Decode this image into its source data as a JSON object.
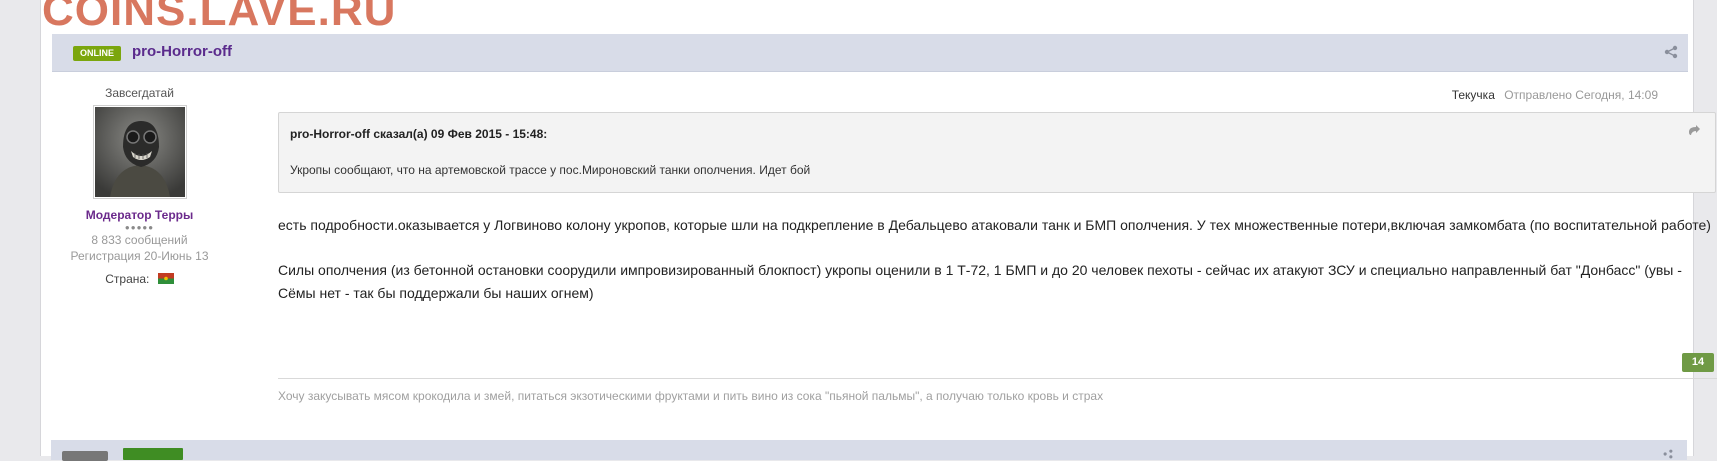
{
  "watermark": "COINS.LAVE.RU",
  "post": {
    "online_label": "ONLINE",
    "author": "pro-Horror-off",
    "rank": "Завсегдатай",
    "group": "Модератор Терры",
    "pips": "●●●●●",
    "posts_count": "8 833 сообщений",
    "registered": "Регистрация 20-Июнь 13",
    "country_label": "Страна:",
    "meta_user": "Текучка",
    "meta_date": "Отправлено Сегодня, 14:09",
    "quote": {
      "cite": "pro-Horror-off сказал(а) 09 Фев 2015 - 15:48:",
      "text": "Укропы сообщают, что на артемовской трассе у пос.Мироновский танки ополчения. Идет бой"
    },
    "body": [
      "есть подробности.оказывается у Логвиново колону укропов, которые шли на подкрепление в Дебальцево атаковали танк и БМП ополчения. У тех множественные потери,включая замкомбата (по воспитательной работе)",
      "Силы ополчения (из бетонной остановки соорудили импровизированный блокпост) укропы оценили в 1 Т-72, 1 БМП и до 20 человек пехоты - сейчас их атакуют ЗСУ и специально направленный бат \"Донбасс\" (увы - Сёмы нет - так бы поддержали бы наших огнем)"
    ],
    "reputation": "14",
    "signature": "Хочу закусывать мясом крокодила и змей, питаться экзотическими фруктами и пить вино из сока \"пьяной пальмы\", а получаю только кровь и страх"
  },
  "icons": {
    "share": "share-icon",
    "quote": "quote-icon",
    "flag": "flag-icon"
  },
  "colors": {
    "online": "#7ba60d",
    "author": "#5a2a8c",
    "reputation": "#6f9a45",
    "header_bg": "#d8dce8"
  }
}
